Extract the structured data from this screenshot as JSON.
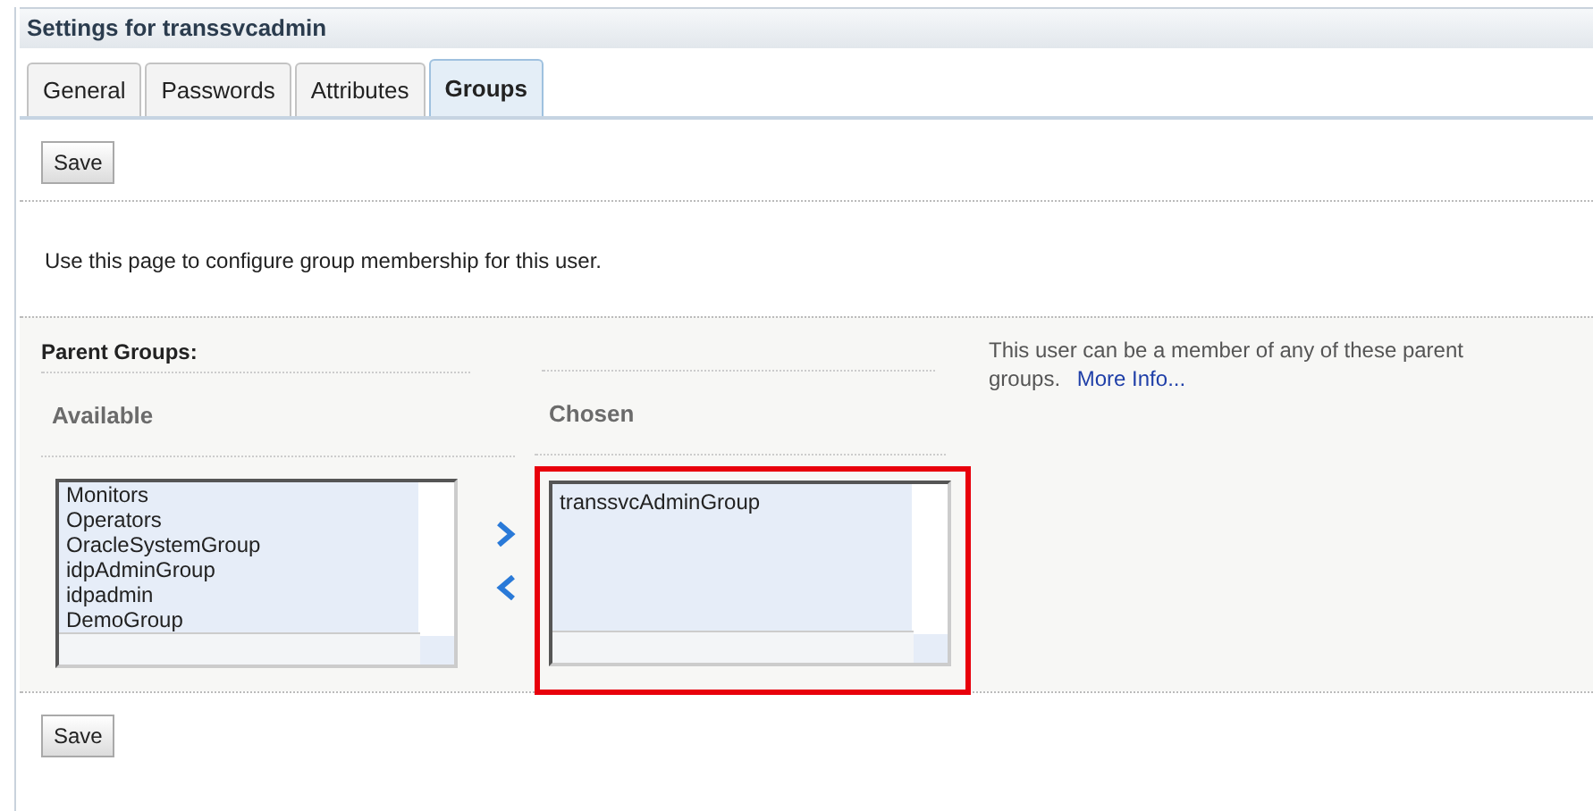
{
  "header": {
    "title": "Settings for transsvcadmin"
  },
  "tabs": [
    {
      "label": "General",
      "selected": false
    },
    {
      "label": "Passwords",
      "selected": false
    },
    {
      "label": "Attributes",
      "selected": false
    },
    {
      "label": "Groups",
      "selected": true
    }
  ],
  "top_button": "Save",
  "intro": "Use this page to configure group membership for this user.",
  "section_title": "Parent Groups:",
  "available": {
    "label": "Available",
    "items": [
      "Monitors",
      "Operators",
      "OracleSystemGroup",
      "idpAdminGroup",
      "idpadmin",
      "DemoGroup"
    ]
  },
  "chosen": {
    "label": "Chosen",
    "items": [
      "transsvcAdminGroup"
    ],
    "highlighted": true
  },
  "help": {
    "text": "This user can be a member of any of these parent groups.",
    "link": "More Info..."
  },
  "bottom_button": "Save"
}
